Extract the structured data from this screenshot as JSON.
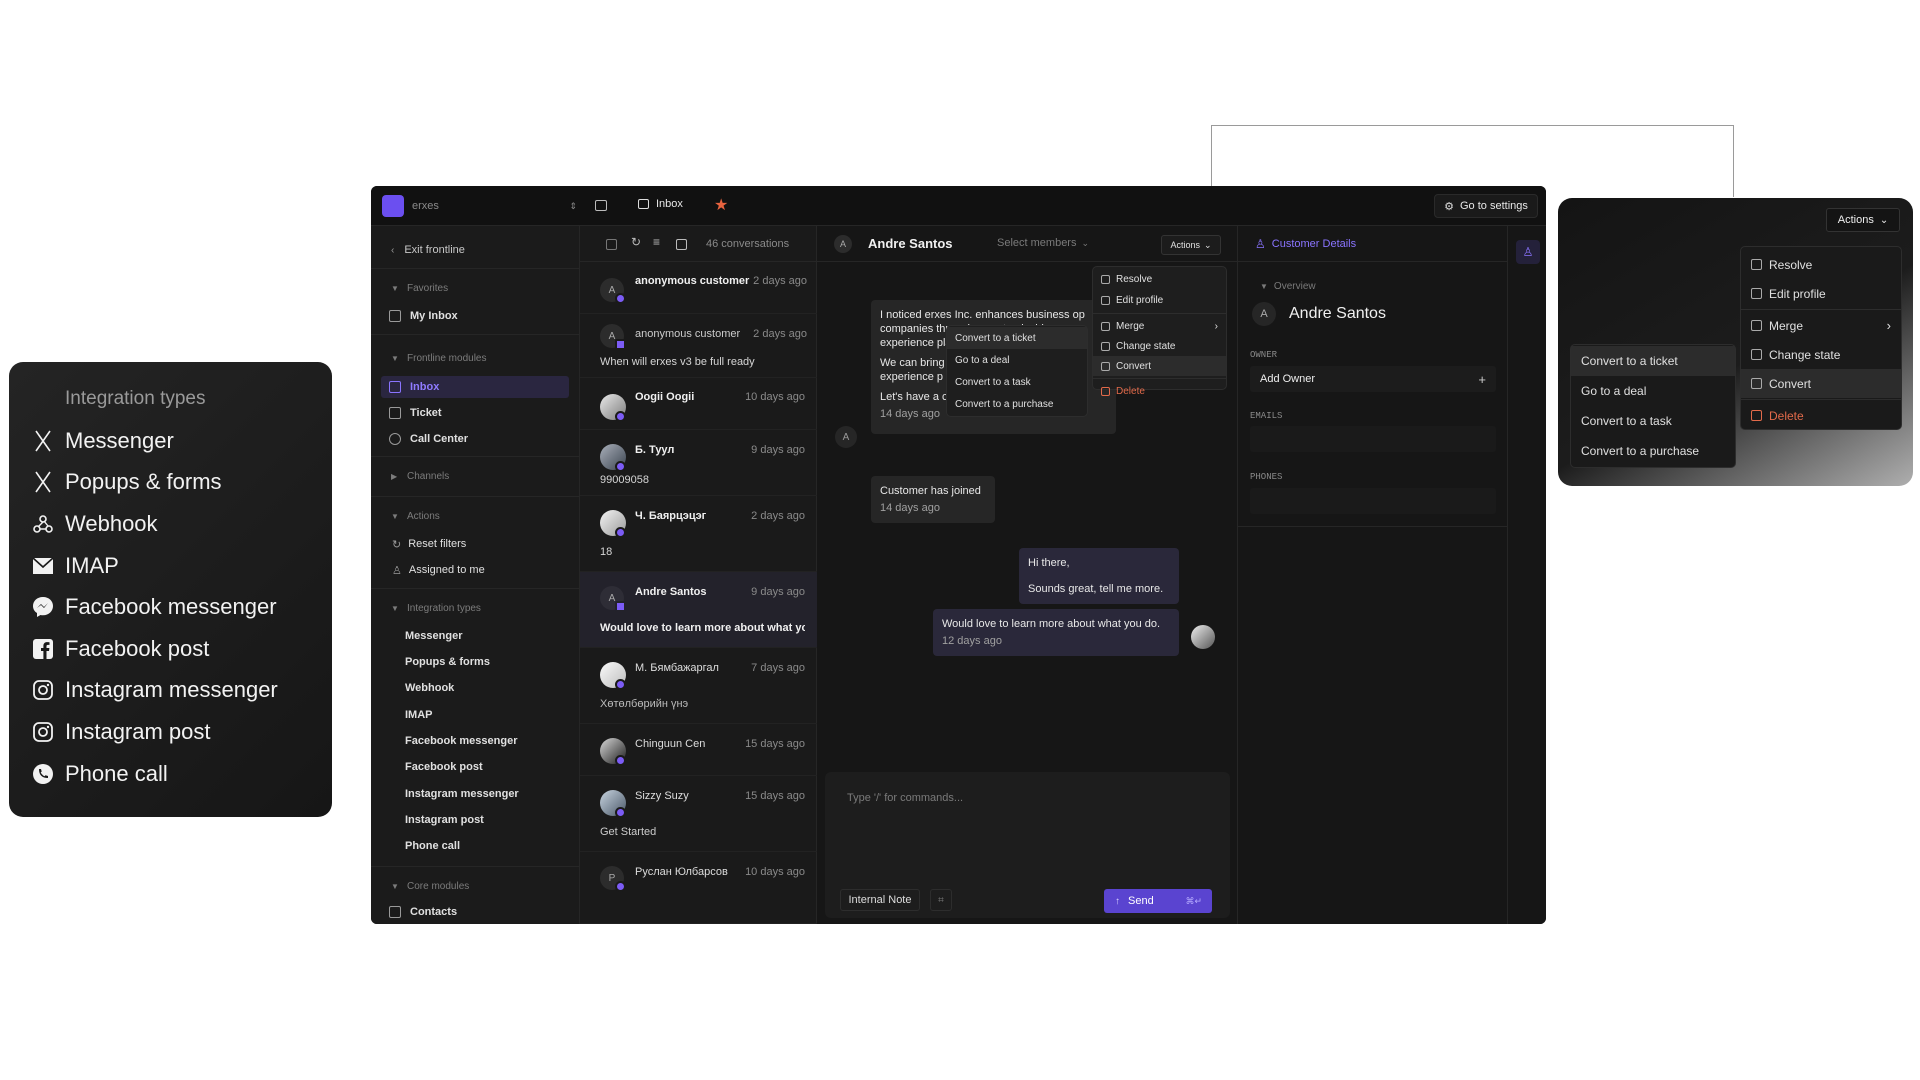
{
  "callout_left": {
    "title": "Integration types",
    "items": [
      {
        "label": "Messenger",
        "icon": "x-icon"
      },
      {
        "label": "Popups & forms",
        "icon": "x-icon"
      },
      {
        "label": "Webhook",
        "icon": "webhook-icon"
      },
      {
        "label": "IMAP",
        "icon": "mail-icon"
      },
      {
        "label": "Facebook messenger",
        "icon": "messenger-icon"
      },
      {
        "label": "Facebook post",
        "icon": "facebook-icon"
      },
      {
        "label": "Instagram messenger",
        "icon": "instagram-icon"
      },
      {
        "label": "Instagram post",
        "icon": "instagram-icon"
      },
      {
        "label": "Phone call",
        "icon": "phone-icon"
      }
    ]
  },
  "topbar": {
    "org": "erxes",
    "breadcrumb": "Inbox",
    "settings": "Go to settings"
  },
  "sidebar": {
    "exit": "Exit frontline",
    "favorites": "Favorites",
    "my_inbox": "My Inbox",
    "frontline": "Frontline modules",
    "inbox": "Inbox",
    "ticket": "Ticket",
    "call_center": "Call Center",
    "channels": "Channels",
    "actions": "Actions",
    "reset_filters": "Reset filters",
    "assigned": "Assigned to me",
    "integration_types": "Integration types",
    "integrations": [
      "Messenger",
      "Popups & forms",
      "Webhook",
      "IMAP",
      "Facebook messenger",
      "Facebook post",
      "Instagram messenger",
      "Instagram post",
      "Phone call"
    ],
    "core": "Core modules",
    "contacts": "Contacts"
  },
  "convlist": {
    "count": "46 conversations",
    "items": [
      {
        "avatar": "A",
        "name": "anonymous customer",
        "time": "2 days ago",
        "snippet": ""
      },
      {
        "avatar": "A",
        "name": "anonymous customer",
        "time": "2 days ago",
        "snippet": "When will erxes v3 be full ready"
      },
      {
        "avatar": "",
        "name": "Oogii Oogii",
        "time": "10 days ago",
        "snippet": ""
      },
      {
        "avatar": "",
        "name": "Б. Туул",
        "time": "9 days ago",
        "snippet": "99009058"
      },
      {
        "avatar": "",
        "name": "Ч. Баярцэцэг",
        "time": "2 days ago",
        "snippet": "18"
      },
      {
        "avatar": "A",
        "name": "Andre Santos",
        "time": "9 days ago",
        "snippet": "Would love to learn more about what you do."
      },
      {
        "avatar": "",
        "name": "М. Бямбажаргал",
        "time": "7 days ago",
        "snippet": "Хөтөлбөрийн үнэ"
      },
      {
        "avatar": "",
        "name": "Chinguun Cen",
        "time": "15 days ago",
        "snippet": ""
      },
      {
        "avatar": "",
        "name": "Sizzy Suzy",
        "time": "15 days ago",
        "snippet": "Get Started"
      },
      {
        "avatar": "P",
        "name": "Руслан Юлбарсов",
        "time": "10 days ago",
        "snippet": ""
      }
    ]
  },
  "chat": {
    "avatar": "A",
    "name": "Andre Santos",
    "members": "Select members",
    "actions": "Actions",
    "msg1_line1": "I noticed erxes Inc. enhances business op",
    "msg1_line2": "companies through a customizable open-",
    "msg1_line3": "experience platform",
    "msg1_line4": "We can bring",
    "msg1_line5": "experience p",
    "msg1_line6": "Let's have a c",
    "msg1_time": "14 days ago",
    "msg2": "Customer has joined",
    "msg2_time": "14 days ago",
    "msg3_line1": "Hi there,",
    "msg3_line2": "Sounds great, tell me more.",
    "msg4": "Would love to learn more about what you do.",
    "msg4_time": "12 days ago",
    "composer_placeholder": "Type '/' for commands...",
    "internal_note": "Internal Note",
    "send": "Send",
    "send_shortcut": "⌘↵"
  },
  "actions_menu": {
    "resolve": "Resolve",
    "edit_profile": "Edit profile",
    "merge": "Merge",
    "change_state": "Change state",
    "convert": "Convert",
    "delete": "Delete"
  },
  "convert_menu": {
    "ticket": "Convert to a ticket",
    "deal": "Go to a deal",
    "task": "Convert to a task",
    "purchase": "Convert to a purchase"
  },
  "customer": {
    "title": "Customer Details",
    "overview": "Overview",
    "avatar": "A",
    "name": "Andre Santos",
    "owner_label": "OWNER",
    "add_owner": "Add Owner",
    "emails_label": "EMAILS",
    "phones_label": "PHONES"
  },
  "colors": {
    "accent": "#6b4ff0",
    "danger": "#e26a4a",
    "bg": "#161616"
  }
}
